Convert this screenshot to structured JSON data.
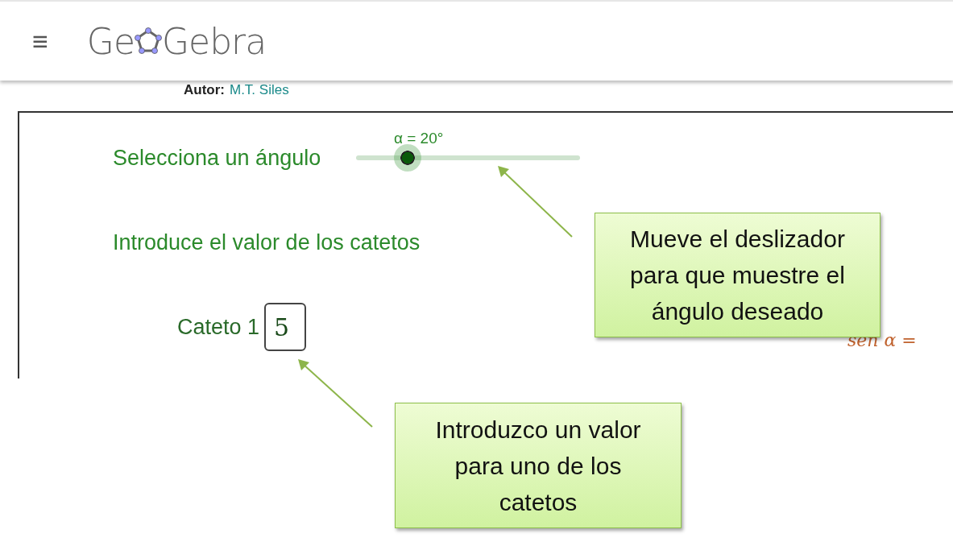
{
  "header": {
    "menu_icon": "≡",
    "logo": {
      "before": "Ge",
      "after": "Gebra"
    }
  },
  "author": {
    "label": "Autor:",
    "name": "M.T. Siles"
  },
  "applet": {
    "slider": {
      "label": "Selecciona un ángulo",
      "reading": "α = 20°",
      "level": 0.23
    },
    "prompt": "Introduce el valor de los catetos",
    "input": {
      "label": "Cateto 1",
      "value": "5"
    },
    "formula": "sen α ="
  },
  "callouts": [
    {
      "text": "Mueve el deslizador para  que muestre el ángulo deseado"
    },
    {
      "text": "Introduzco un valor para uno de los catetos"
    }
  ]
}
